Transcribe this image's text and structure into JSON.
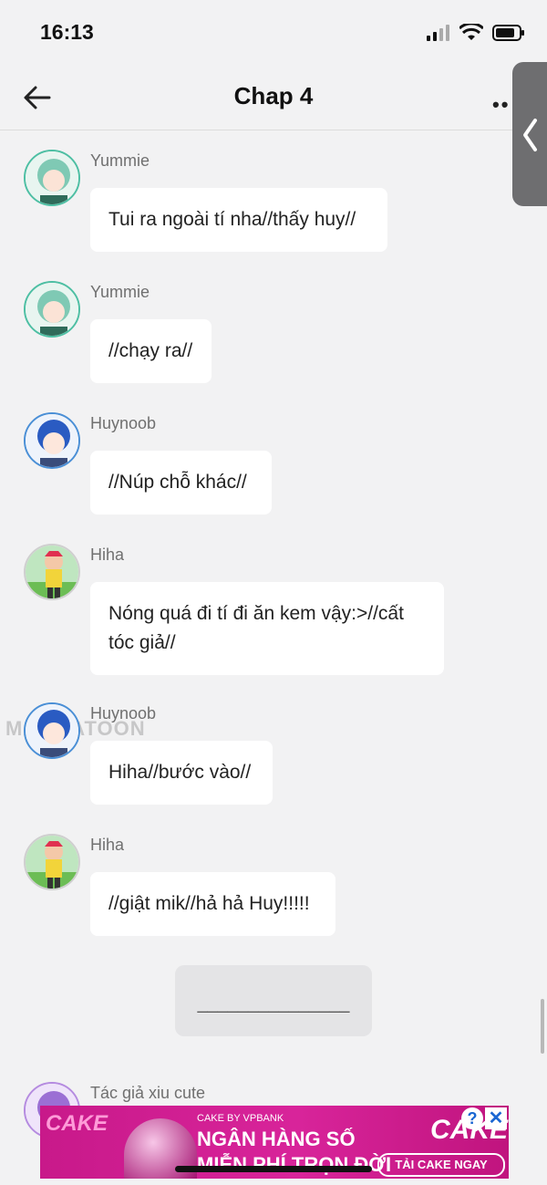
{
  "status_bar": {
    "time": "16:13"
  },
  "nav": {
    "title": "Chap 4",
    "more": "••"
  },
  "messages": [
    {
      "name": "Yummie",
      "text": "Tui ra ngoài tí nha//thấy huy//"
    },
    {
      "name": "Yummie",
      "text": "//chạy ra//"
    },
    {
      "name": "Huynoob",
      "text": "//Núp chỗ khác//"
    },
    {
      "name": "Hiha",
      "text": "Nóng quá đi tí đi ăn kem vậy:>//cất tóc giả//"
    },
    {
      "name": "Huynoob",
      "text": "Hiha//bước vào//"
    },
    {
      "name": "Hiha",
      "text": "//giật mik//hả hả Huy!!!!!"
    },
    {
      "name": "Tác giả xiu cute"
    }
  ],
  "divider": "_______________",
  "watermark": "MANGATOON",
  "ad": {
    "logo_left": "CAKE",
    "small": "CAKE BY VPBANK",
    "line1": "NGÂN HÀNG SỐ",
    "line2": "MIỄN PHÍ TRỌN ĐỜI",
    "brand": "CAKE",
    "cta": "TẢI CAKE NGAY",
    "info": "?",
    "close": "✕"
  },
  "colors": {
    "background": "#f2f2f3",
    "bubble": "#ffffff",
    "ad_pink": "#d8249a",
    "handle": "#6e6e70"
  }
}
